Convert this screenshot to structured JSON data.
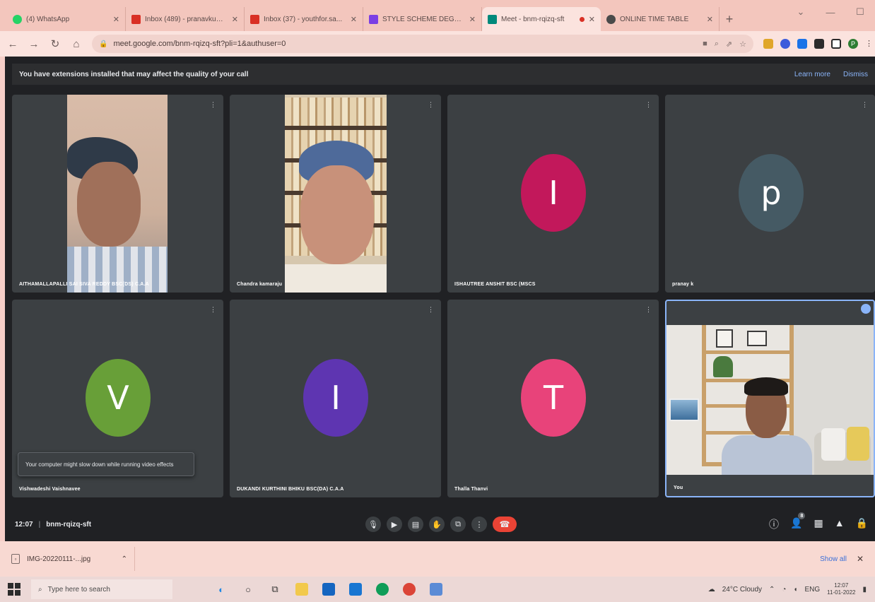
{
  "browser": {
    "tabs": [
      {
        "title": "(4) WhatsApp",
        "color": "#25d366"
      },
      {
        "title": "Inbox (489) - pranavkumar...",
        "color": "#d93025"
      },
      {
        "title": "Inbox (37) - youthfor.sa...",
        "color": "#d93025"
      },
      {
        "title": "STYLE SCHEME DEGREE C...",
        "color": "#7b3fe4"
      },
      {
        "title": "Meet - bnm-rqizq-sft",
        "color": "#00897b",
        "active": true
      },
      {
        "title": "ONLINE TIME TABLE",
        "color": "#4a4a4a"
      }
    ],
    "new_tab": "+",
    "url": "meet.google.com/bnm-rqizq-sft?pli=1&authuser=0"
  },
  "meet": {
    "banner_text": "You have extensions installed that may affect the quality of your call",
    "banner_links": [
      "Learn more",
      "Dismiss"
    ],
    "participants": [
      {
        "name": "AITHAMALLAPALLI SAI SIVA REDDY BSC(DS) C.A.A",
        "type": "video"
      },
      {
        "name": "Chandra kamaraju",
        "type": "video"
      },
      {
        "name": "ISHAUTREE ANSHIT BSC (MSCS",
        "type": "avatar",
        "initial": "I",
        "color": "#c2185b"
      },
      {
        "name": "pranay k",
        "type": "avatar",
        "initial": "p",
        "color": "#455a64"
      },
      {
        "name": "Vishwadeshi Vaishnavee",
        "type": "avatar",
        "initial": "V",
        "color": "#689f38"
      },
      {
        "name": "DUKANDI KURTHINI BHIKU BSC(DA) C.A.A",
        "type": "avatar",
        "initial": "I",
        "color": "#5e35b1"
      },
      {
        "name": "Thalla Thanvi",
        "type": "avatar",
        "initial": "T",
        "color": "#e8437a"
      },
      {
        "name": "You",
        "type": "self"
      }
    ],
    "tooltip": "Your computer might slow down while running video effects",
    "meeting_time": "12:07",
    "meeting_code": "bnm-rqizq-sft",
    "participant_count": "8"
  },
  "downloads": {
    "file_name": "IMG-20220111-...jpg",
    "show_all": "Show all"
  },
  "taskbar": {
    "search_placeholder": "Type here to search",
    "weather": "24°C Cloudy",
    "language": "ENG",
    "time": "12:07",
    "date": "11-01-2022"
  }
}
